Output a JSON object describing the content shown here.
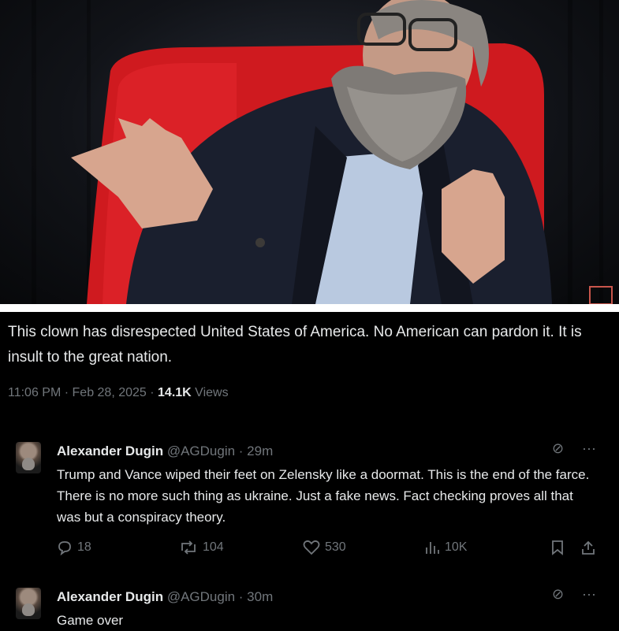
{
  "tweet": {
    "text": "This clown has disrespected United States of America. No American can pardon it. It is insult to the great nation.",
    "time": "11:06 PM · Feb 28, 2025 · ",
    "views_count": "14.1K",
    "views_label": " Views"
  },
  "replies": [
    {
      "name": "Alexander Dugin",
      "handle": "@AGDugin · 29m",
      "text": "Trump and Vance wiped their feet on Zelensky like a doormat. This is the end of the farce. There is no more such thing as ukraine. Just a fake news. Fact checking proves all that was but a conspiracy theory.",
      "replies_count": "18",
      "reposts_count": "104",
      "likes_count": "530",
      "views_count": "10K"
    },
    {
      "name": "Alexander Dugin",
      "handle": "@AGDugin · 30m",
      "text": "Game over"
    }
  ],
  "colors": {
    "accent": "#e7e9ea",
    "muted": "#71767b",
    "chair": "#d0161b"
  },
  "icons": [
    "reply-icon",
    "repost-icon",
    "like-icon",
    "views-icon",
    "bookmark-icon",
    "share-icon",
    "grok-icon",
    "more-icon"
  ]
}
